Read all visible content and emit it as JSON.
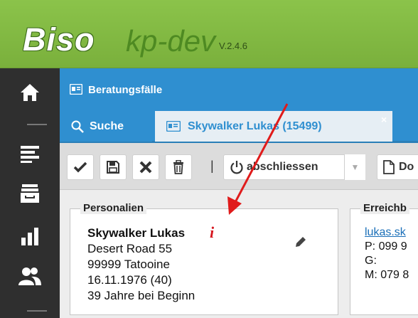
{
  "header": {
    "brand": "Biso",
    "environment": "kp-dev",
    "version": "V.2.4.6"
  },
  "sidebar": {
    "items": [
      {
        "name": "home",
        "icon": "home-icon"
      },
      {
        "name": "list",
        "icon": "list-icon"
      },
      {
        "name": "archive",
        "icon": "inbox-icon"
      },
      {
        "name": "stats",
        "icon": "bar-chart-icon"
      },
      {
        "name": "users",
        "icon": "users-icon"
      }
    ]
  },
  "titlebar": {
    "title": "Beratungsfälle"
  },
  "tabs": {
    "search_label": "Suche",
    "record_label": "Skywalker Lukas (15499)",
    "close_symbol": "×"
  },
  "toolbar": {
    "divider": "|",
    "close_case_label": "abschliessen",
    "doc_label": "Do"
  },
  "personalien": {
    "legend": "Personalien",
    "name": "Skywalker Lukas",
    "info_marker": "i",
    "address1": "Desert Road 55",
    "address2": "99999 Tatooine",
    "birth": "16.11.1976 (40)",
    "age_at_start": "39 Jahre bei Beginn"
  },
  "erreichbarkeit": {
    "legend": "Erreichb",
    "email": "lukas.sk",
    "phone_p": "P: 099 9",
    "phone_g": "G:",
    "phone_m": "M: 079 8"
  },
  "colors": {
    "header_green": "#8bc34a",
    "brand_blue": "#2f8fd0",
    "sidebar_dark": "#2f2f2f",
    "annotation_red": "#d6161e"
  }
}
